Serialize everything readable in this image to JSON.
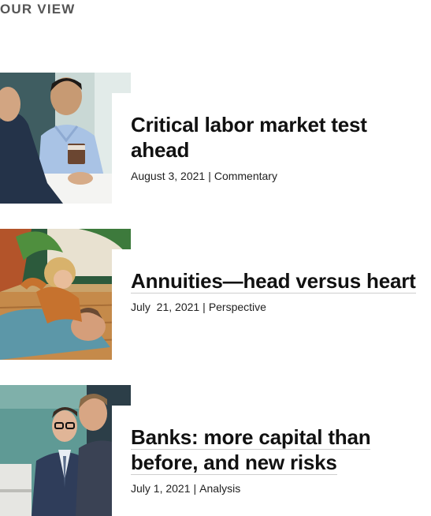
{
  "section": {
    "title": "OUR VIEW"
  },
  "articles": [
    {
      "headline": "Critical labor market test ahead",
      "date": "August 3, 2021",
      "separator": "|",
      "category": "Commentary",
      "image": "two-men-meeting-coffee-photo"
    },
    {
      "headline": "Annuities—head versus heart",
      "date": "July  21, 2021",
      "separator": "|",
      "category": "Perspective",
      "image": "child-playing-with-father-on-floor-photo"
    },
    {
      "headline": "Banks: more capital than before, and new risks",
      "date": "July 1, 2021",
      "separator": "|",
      "category": "Analysis",
      "image": "businessmen-conversation-office-photo"
    }
  ],
  "colors": {
    "section_title": "#555555",
    "headline": "#111111",
    "meta": "#222222"
  }
}
